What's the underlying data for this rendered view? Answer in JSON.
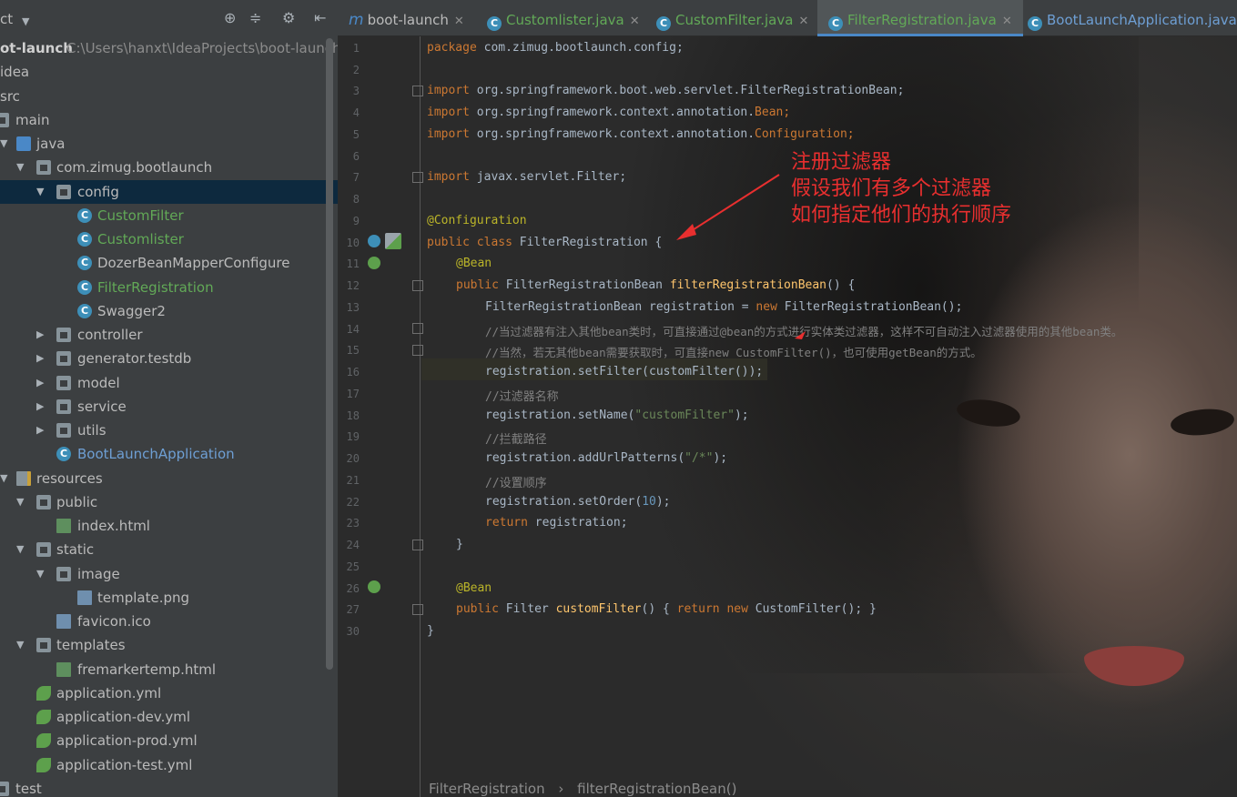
{
  "sidebar": {
    "title": "ct",
    "tree": [
      {
        "label": "ot-launch",
        "extra": "C:\\Users\\hanxt\\IdeaProjects\\boot-launch",
        "bold": true
      },
      {
        "label": "idea"
      },
      {
        "label": "src"
      },
      {
        "label": "main"
      },
      {
        "label": "java"
      },
      {
        "label": "com.zimug.bootlaunch"
      },
      {
        "label": "config"
      },
      {
        "label": "CustomFilter"
      },
      {
        "label": "Customlister"
      },
      {
        "label": "DozerBeanMapperConfigure"
      },
      {
        "label": "FilterRegistration"
      },
      {
        "label": "Swagger2"
      },
      {
        "label": "controller"
      },
      {
        "label": "generator.testdb"
      },
      {
        "label": "model"
      },
      {
        "label": "service"
      },
      {
        "label": "utils"
      },
      {
        "label": "BootLaunchApplication"
      },
      {
        "label": "resources"
      },
      {
        "label": "public"
      },
      {
        "label": "index.html"
      },
      {
        "label": "static"
      },
      {
        "label": "image"
      },
      {
        "label": "template.png"
      },
      {
        "label": "favicon.ico"
      },
      {
        "label": "templates"
      },
      {
        "label": "fremarkertemp.html"
      },
      {
        "label": "application.yml"
      },
      {
        "label": "application-dev.yml"
      },
      {
        "label": "application-prod.yml"
      },
      {
        "label": "application-test.yml"
      },
      {
        "label": "test"
      }
    ]
  },
  "tabs": [
    {
      "label": "boot-launch"
    },
    {
      "label": "Customlister.java"
    },
    {
      "label": "CustomFilter.java"
    },
    {
      "label": "FilterRegistration.java"
    },
    {
      "label": "BootLaunchApplication.java"
    }
  ],
  "editor": {
    "line_numbers": [
      "1",
      "2",
      "3",
      "4",
      "5",
      "6",
      "7",
      "8",
      "9",
      "10",
      "11",
      "12",
      "13",
      "14",
      "15",
      "16",
      "17",
      "18",
      "19",
      "20",
      "21",
      "22",
      "23",
      "24",
      "25",
      "26",
      "27",
      "30"
    ],
    "code": {
      "l1_kw": "package",
      "l1_rest": " com.zimug.bootlaunch.config;",
      "l3_kw": "import",
      "l3_rest": " org.springframework.boot.web.servlet.FilterRegistrationBean;",
      "l4_kw": "import",
      "l4_a": " org.springframework.context.annotation.",
      "l4_b": "Bean",
      "l4_c": ";",
      "l5_kw": "import",
      "l5_a": " org.springframework.context.annotation.",
      "l5_b": "Configuration",
      "l5_c": ";",
      "l7_kw": "import",
      "l7_rest": " javax.servlet.Filter;",
      "l9": "@Configuration",
      "l10_kw": "public class",
      "l10_rest": " FilterRegistration {",
      "l11": "@Bean",
      "l12_kw": "public",
      "l12_a": " FilterRegistrationBean ",
      "l12_fn": "filterRegistrationBean",
      "l12_b": "() {",
      "l13_a": "FilterRegistrationBean registration = ",
      "l13_kw": "new",
      "l13_b": " FilterRegistrationBean();",
      "l14": "//当过滤器有注入其他bean类时，可直接通过@bean的方式进行实体类过滤器，这样不可自动注入过滤器使用的其他bean类。",
      "l15": "//当然，若无其他bean需要获取时，可直接new CustomFilter()，也可使用getBean的方式。",
      "l16": "registration.setFilter(customFilter());",
      "l17": "//过滤器名称",
      "l18_a": "registration.setName(",
      "l18_str": "\"customFilter\"",
      "l18_b": ");",
      "l19": "//拦截路径",
      "l20_a": "registration.addUrlPatterns(",
      "l20_str": "\"/*\"",
      "l20_b": ");",
      "l21": "//设置顺序",
      "l22_a": "registration.setOrder(",
      "l22_num": "10",
      "l22_b": ");",
      "l23_kw": "return",
      "l23_rest": " registration;",
      "l24": "}",
      "l26": "@Bean",
      "l27_kw": "public",
      "l27_a": " Filter ",
      "l27_fn": "customFilter",
      "l27_b": "() { ",
      "l27_kw2": "return new",
      "l27_c": " CustomFilter(); }",
      "l30": "}"
    }
  },
  "annotation": {
    "line1": "注册过滤器",
    "line2": "假设我们有多个过滤器",
    "line3": "如何指定他们的执行顺序"
  },
  "breadcrumb": {
    "item1": "FilterRegistration",
    "sep": "›",
    "item2": "filterRegistrationBean()"
  },
  "colors": {
    "keyword": "#cc7832",
    "annotation": "#bbb529",
    "function": "#ffc66d",
    "string": "#6a8759",
    "comment": "#808080",
    "number": "#6897bb",
    "red_note": "#e82f2f",
    "active_tab_underline": "#4a88c7"
  }
}
